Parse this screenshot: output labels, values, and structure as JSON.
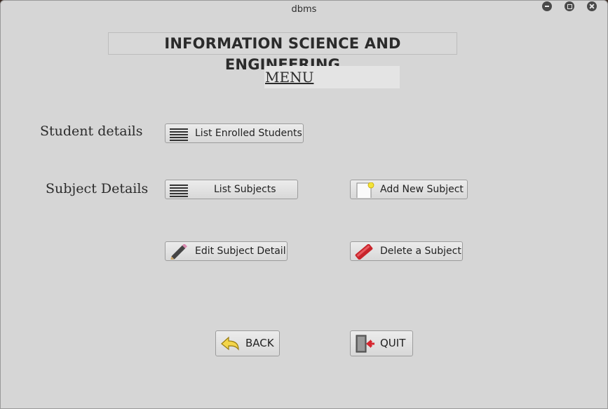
{
  "window": {
    "title": "dbms"
  },
  "header": {
    "title": "INFORMATION SCIENCE AND ENGINEERING",
    "menu_label": "MENU"
  },
  "sections": {
    "student_label": "Student details",
    "subject_label": "Subject Details"
  },
  "buttons": {
    "list_enrolled": "List Enrolled Students",
    "list_subjects": "List Subjects",
    "add_subject": "Add New Subject",
    "edit_subject": "Edit Subject Detail",
    "delete_subject": "Delete a Subject",
    "back": "BACK",
    "quit": "QUIT"
  },
  "icons": {
    "list_enrolled": "list-lines-icon",
    "list_subjects": "list-lines-icon",
    "add_subject": "new-document-icon",
    "edit_subject": "pencil-icon",
    "delete_subject": "eraser-icon",
    "back": "back-arrow-icon",
    "quit": "exit-door-icon"
  }
}
